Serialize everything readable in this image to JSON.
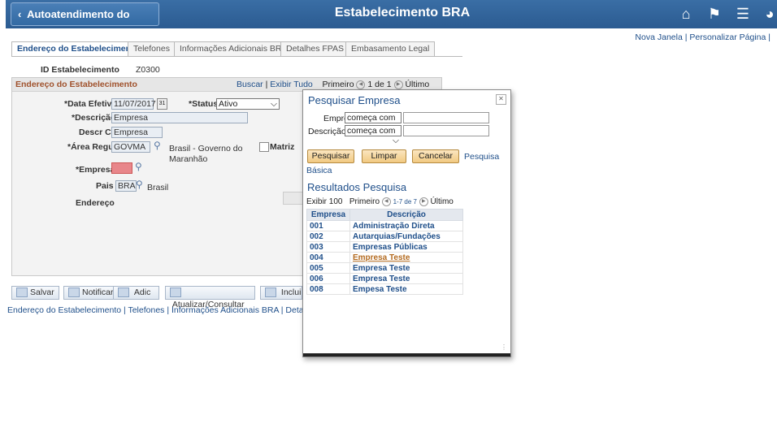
{
  "header": {
    "back_label": "Autoatendimento do Gerente",
    "title": "Estabelecimento BRA",
    "links": [
      "Nova Janela",
      "Personalizar Página"
    ]
  },
  "tabs": [
    {
      "label": "Endereço do Estabelecimento",
      "active": true
    },
    {
      "label": "Telefones"
    },
    {
      "label": "Informações Adicionais BRA"
    },
    {
      "label": "Detalhes FPAS"
    },
    {
      "label": "Embasamento Legal"
    }
  ],
  "form": {
    "id_label": "ID Estabelecimento",
    "id_value": "Z0300",
    "group_title": "Endereço do Estabelecimento",
    "nav": {
      "search": "Buscar",
      "viewall": "Exibir Tudo",
      "first": "Primeiro",
      "count": "1 de 1",
      "last": "Último"
    },
    "data_efetiva_label": "*Data Efetiva",
    "data_efetiva": "11/07/2017",
    "status_label": "*Status",
    "status": "Ativo",
    "descricao_label": "*Descrição",
    "descricao": "Empresa",
    "descr_curta_label": "Descr Curta",
    "descr_curta": "Empresa",
    "area_label": "*Área Regul",
    "area": "GOVMA",
    "area_desc": "Brasil - Governo do Maranhão",
    "matriz_label": "Matriz",
    "empresa_label": "*Empresa",
    "pais_label": "Pais",
    "pais": "BRA",
    "pais_desc": "Brasil",
    "endereco_label": "Endereço"
  },
  "buttons": {
    "salvar": "Salvar",
    "notificar": "Notificar",
    "adic": "Adic",
    "atualizar": "Atualizar/Consultar",
    "incluir": "Incluir r"
  },
  "bottom_links": "Endereço do Estabelecimento | Telefones | Informações Adicionais BRA | Detalhes FPAS |",
  "modal": {
    "title": "Pesquisar Empresa",
    "empresa_label": "Empresa",
    "descricao_label": "Descrição",
    "operator": "começa com",
    "btn_pesquisar": "Pesquisar",
    "btn_limpar": "Limpar",
    "btn_cancelar": "Cancelar",
    "basic_link_1": "Pesquisa",
    "basic_link_2": "Básica",
    "results_title": "Resultados Pesquisa",
    "exibir": "Exibir 100",
    "first": "Primeiro",
    "range": "1-7 de 7",
    "last": "Último",
    "col_empresa": "Empresa",
    "col_descricao": "Descrição",
    "rows": [
      {
        "code": "001",
        "desc": "Administração Direta"
      },
      {
        "code": "002",
        "desc": "Autarquias/Fundações"
      },
      {
        "code": "003",
        "desc": "Empresas Públicas"
      },
      {
        "code": "004",
        "desc": "Empresa Teste"
      },
      {
        "code": "005",
        "desc": "Empresa Teste"
      },
      {
        "code": "006",
        "desc": "Empresa Teste"
      },
      {
        "code": "008",
        "desc": "Empesa Teste"
      }
    ]
  }
}
